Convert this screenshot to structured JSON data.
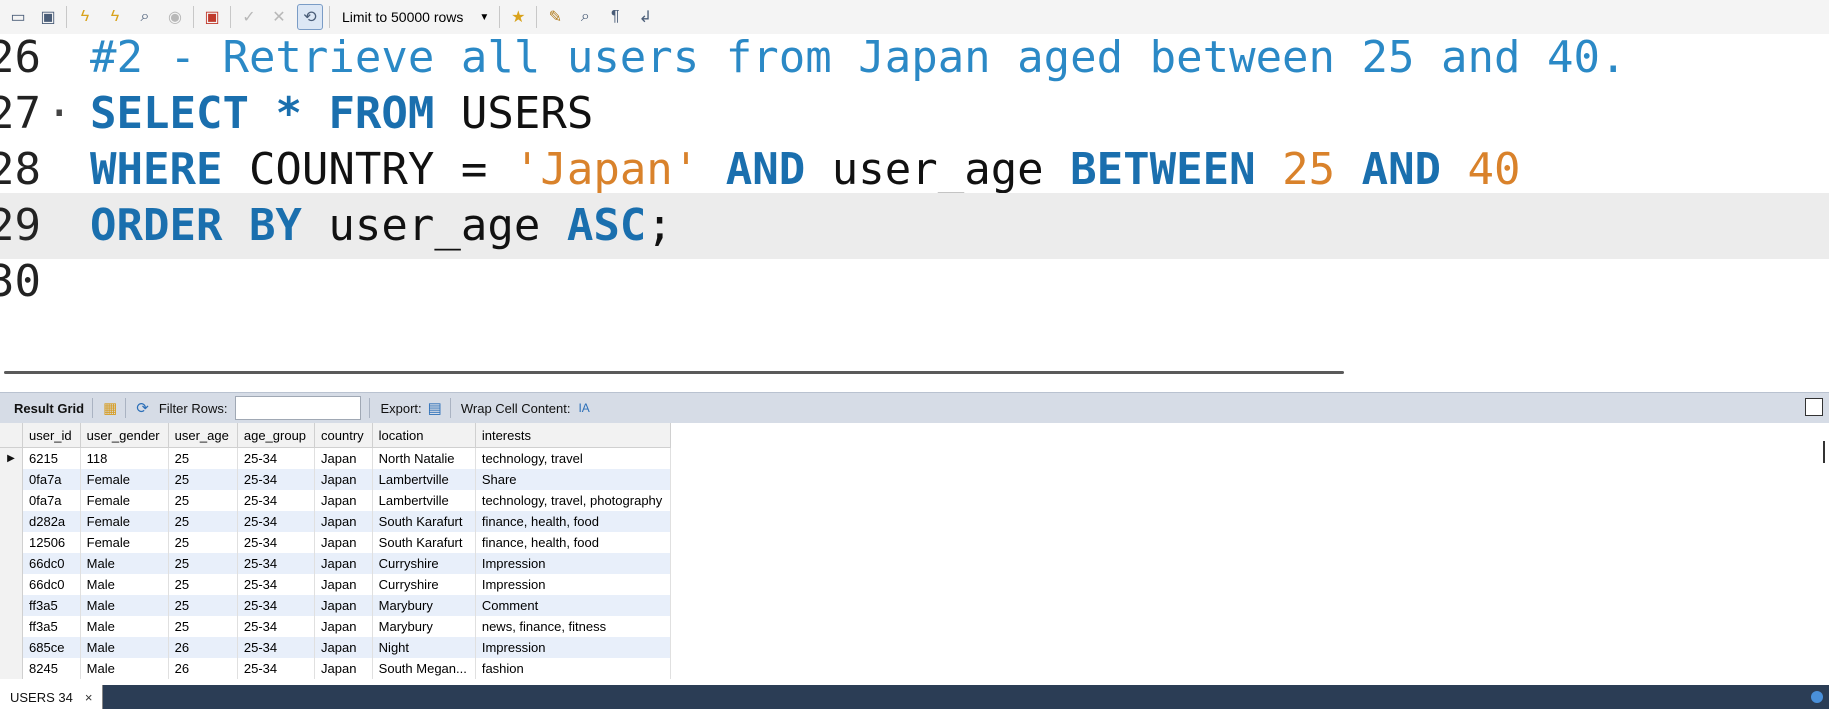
{
  "toolbar": {
    "limit_label": "Limit to 50000 rows"
  },
  "editor": {
    "lines": [
      {
        "num": "26",
        "marker": "",
        "segments": [
          {
            "t": "#2 - Retrieve all users from Japan aged between 25 and 40.",
            "c": "comment"
          }
        ]
      },
      {
        "num": "27",
        "marker": "·",
        "segments": [
          {
            "t": "SELECT",
            "c": "kw"
          },
          {
            "t": " * ",
            "c": "kw"
          },
          {
            "t": "FROM",
            "c": "kw"
          },
          {
            "t": " USERS",
            "c": "plain"
          }
        ]
      },
      {
        "num": "28",
        "marker": "",
        "segments": [
          {
            "t": "WHERE",
            "c": "kw"
          },
          {
            "t": " COUNTRY = ",
            "c": "plain"
          },
          {
            "t": "'Japan'",
            "c": "str"
          },
          {
            "t": " AND ",
            "c": "kw"
          },
          {
            "t": "user_age ",
            "c": "plain"
          },
          {
            "t": "BETWEEN",
            "c": "kw"
          },
          {
            "t": " 25 ",
            "c": "num"
          },
          {
            "t": "AND",
            "c": "kw"
          },
          {
            "t": " 40",
            "c": "num"
          }
        ]
      },
      {
        "num": "29",
        "marker": "",
        "segments": [
          {
            "t": "ORDER BY",
            "c": "kw"
          },
          {
            "t": " user_age ",
            "c": "plain"
          },
          {
            "t": "ASC",
            "c": "kw"
          },
          {
            "t": ";",
            "c": "plain"
          }
        ]
      },
      {
        "num": "30",
        "marker": "",
        "segments": []
      }
    ]
  },
  "result_bar": {
    "result_grid": "Result Grid",
    "filter_rows": "Filter Rows:",
    "filter_value": "",
    "export": "Export:",
    "wrap": "Wrap Cell Content:"
  },
  "grid": {
    "columns": [
      "user_id",
      "user_gender",
      "user_age",
      "age_group",
      "country",
      "location",
      "interests"
    ],
    "rows": [
      [
        "6215",
        "118",
        "25",
        "25-34",
        "Japan",
        "North Natalie",
        "technology, travel"
      ],
      [
        "0fa7a",
        "Female",
        "25",
        "25-34",
        "Japan",
        "Lambertville",
        "Share"
      ],
      [
        "0fa7a",
        "Female",
        "25",
        "25-34",
        "Japan",
        "Lambertville",
        "technology, travel, photography"
      ],
      [
        "d282a",
        "Female",
        "25",
        "25-34",
        "Japan",
        "South Karafurt",
        "finance, health, food"
      ],
      [
        "12506",
        "Female",
        "25",
        "25-34",
        "Japan",
        "South Karafurt",
        "finance, health, food"
      ],
      [
        "66dc0",
        "Male",
        "25",
        "25-34",
        "Japan",
        "Curryshire",
        "Impression"
      ],
      [
        "66dc0",
        "Male",
        "25",
        "25-34",
        "Japan",
        "Curryshire",
        "Impression"
      ],
      [
        "ff3a5",
        "Male",
        "25",
        "25-34",
        "Japan",
        "Marybury",
        "Comment"
      ],
      [
        "ff3a5",
        "Male",
        "25",
        "25-34",
        "Japan",
        "Marybury",
        "news, finance, fitness"
      ],
      [
        "685ce",
        "Male",
        "26",
        "25-34",
        "Japan",
        "Night",
        "Impression"
      ],
      [
        "8245",
        "Male",
        "26",
        "25-34",
        "Japan",
        "South Megan...",
        "fashion"
      ]
    ]
  },
  "status": {
    "tab_label": "USERS 34",
    "close": "×"
  }
}
